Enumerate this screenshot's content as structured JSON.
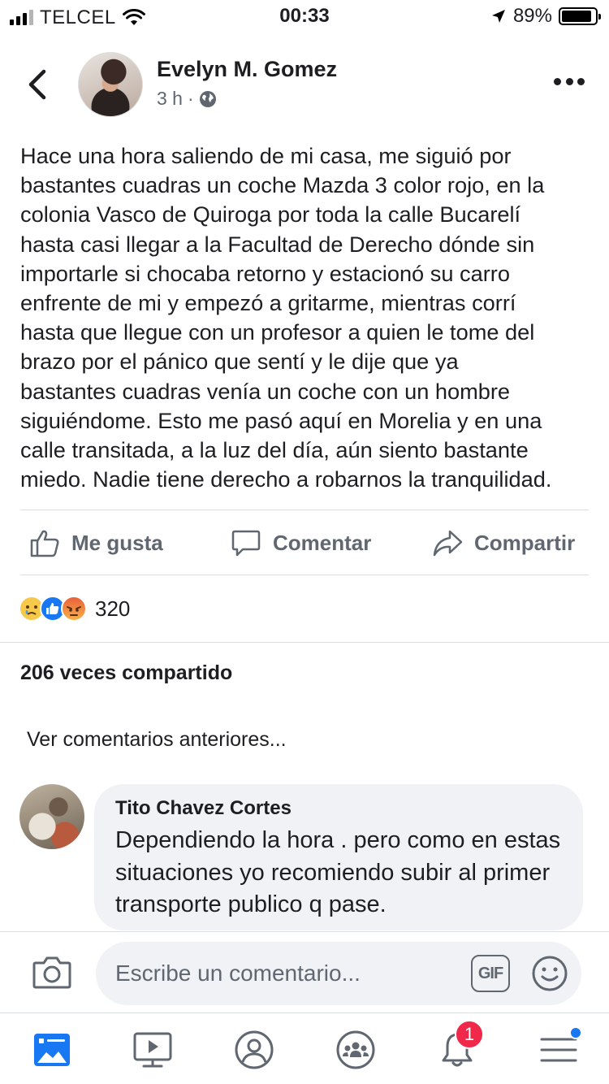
{
  "status_bar": {
    "carrier": "TELCEL",
    "time": "00:33",
    "battery": "89%",
    "battery_level": 0.89,
    "signal_bars": 3
  },
  "post": {
    "author": "Evelyn M. Gomez",
    "time": "3 h",
    "separator": "·",
    "body": "Hace una hora saliendo de mi casa, me siguió por\nbastantes cuadras un coche Mazda 3 color rojo, en la\ncolonia Vasco de Quiroga por toda la calle Bucarelí\nhasta casi llegar a la Facultad de Derecho dónde sin\nimportarle si chocaba retorno y estacionó su carro\nenfrente de mi y empezó a gritarme, mientras corrí\nhasta que llegue con un profesor a quien le tome del\nbrazo por el pánico que sentí y le dije que ya\nbastantes cuadras venía un coche con un hombre\nsiguiéndome. Esto me pasó aquí en Morelia y en una\ncalle transitada, a la luz del día, aún siento bastante\nmiedo. Nadie tiene derecho a robarnos la tranquilidad."
  },
  "actions": {
    "like": "Me gusta",
    "comment": "Comentar",
    "share": "Compartir"
  },
  "reactions": {
    "count": "320",
    "types": [
      "sad",
      "like",
      "angry"
    ]
  },
  "shares_text": "206 veces compartido",
  "previous_comments": "Ver comentarios anteriores...",
  "comment": {
    "author": "Tito Chavez Cortes",
    "text": "Dependiendo la hora . pero como en estas situaciones yo recomiendo subir al primer transporte publico q pase."
  },
  "composer": {
    "placeholder": "Escribe un comentario...",
    "gif_label": "GIF"
  },
  "nav": {
    "items": [
      "news-feed",
      "watch",
      "profile",
      "groups",
      "notifications",
      "menu"
    ],
    "notifications_badge": "1"
  },
  "colors": {
    "brand_blue": "#1877f2",
    "text_primary": "#1c1e21",
    "text_secondary": "#606770",
    "badge_red": "#f02849",
    "bubble_bg": "#f0f2f5"
  }
}
